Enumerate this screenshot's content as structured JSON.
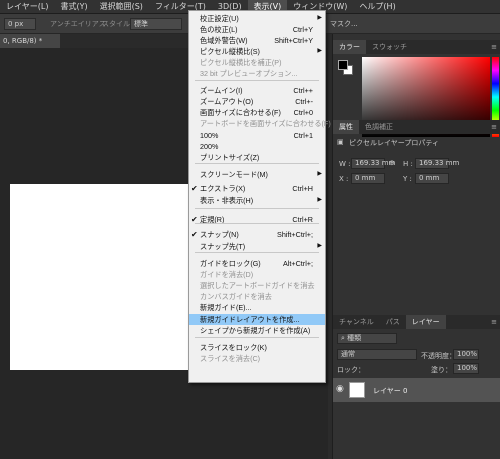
{
  "menubar": {
    "items": [
      "レイヤー(L)",
      "書式(Y)",
      "選択範囲(S)",
      "フィルター(T)",
      "3D(D)",
      "表示(V)",
      "ウィンドウ(W)",
      "ヘルプ(H)"
    ],
    "active_index": 5
  },
  "options_bar": {
    "field_value": "0 px",
    "antialias_label": "アンチエイリアス",
    "style_label": "スタイル：",
    "style_value": "標準",
    "right_text": "マスク..."
  },
  "document_tab": {
    "label": "0, RGB/8) *"
  },
  "view_menu": {
    "items": [
      {
        "label": "校正設定(U)",
        "shortcut": "",
        "submenu": true,
        "disabled": false,
        "checked": false,
        "highlight": false
      },
      {
        "label": "色の校正(L)",
        "shortcut": "Ctrl+Y",
        "submenu": false,
        "disabled": false,
        "checked": false,
        "highlight": false
      },
      {
        "label": "色域外警告(W)",
        "shortcut": "Shift+Ctrl+Y",
        "submenu": false,
        "disabled": false,
        "checked": false,
        "highlight": false
      },
      {
        "label": "ピクセル縦横比(S)",
        "shortcut": "",
        "submenu": true,
        "disabled": false,
        "checked": false,
        "highlight": false
      },
      {
        "label": "ピクセル縦横比を補正(P)",
        "shortcut": "",
        "submenu": false,
        "disabled": true,
        "checked": false,
        "highlight": false
      },
      {
        "label": "32 bit プレビューオプション...",
        "shortcut": "",
        "submenu": false,
        "disabled": true,
        "checked": false,
        "highlight": false
      },
      {
        "label": "ズームイン(I)",
        "shortcut": "Ctrl++",
        "submenu": false,
        "disabled": false,
        "checked": false,
        "highlight": false
      },
      {
        "label": "ズームアウト(O)",
        "shortcut": "Ctrl+-",
        "submenu": false,
        "disabled": false,
        "checked": false,
        "highlight": false
      },
      {
        "label": "画面サイズに合わせる(F)",
        "shortcut": "Ctrl+0",
        "submenu": false,
        "disabled": false,
        "checked": false,
        "highlight": false
      },
      {
        "label": "アートボードを画面サイズに合わせる(F)",
        "shortcut": "",
        "submenu": false,
        "disabled": true,
        "checked": false,
        "highlight": false
      },
      {
        "label": "100%",
        "shortcut": "Ctrl+1",
        "submenu": false,
        "disabled": false,
        "checked": false,
        "highlight": false
      },
      {
        "label": "200%",
        "shortcut": "",
        "submenu": false,
        "disabled": false,
        "checked": false,
        "highlight": false
      },
      {
        "label": "プリントサイズ(Z)",
        "shortcut": "",
        "submenu": false,
        "disabled": false,
        "checked": false,
        "highlight": false
      },
      {
        "label": "スクリーンモード(M)",
        "shortcut": "",
        "submenu": true,
        "disabled": false,
        "checked": false,
        "highlight": false
      },
      {
        "label": "エクストラ(X)",
        "shortcut": "Ctrl+H",
        "submenu": false,
        "disabled": false,
        "checked": true,
        "highlight": false
      },
      {
        "label": "表示・非表示(H)",
        "shortcut": "",
        "submenu": true,
        "disabled": false,
        "checked": false,
        "highlight": false
      },
      {
        "label": "定規(R)",
        "shortcut": "Ctrl+R",
        "submenu": false,
        "disabled": false,
        "checked": true,
        "highlight": false
      },
      {
        "label": "スナップ(N)",
        "shortcut": "Shift+Ctrl+;",
        "submenu": false,
        "disabled": false,
        "checked": true,
        "highlight": false
      },
      {
        "label": "スナップ先(T)",
        "shortcut": "",
        "submenu": true,
        "disabled": false,
        "checked": false,
        "highlight": false
      },
      {
        "label": "ガイドをロック(G)",
        "shortcut": "Alt+Ctrl+;",
        "submenu": false,
        "disabled": false,
        "checked": false,
        "highlight": false
      },
      {
        "label": "ガイドを消去(D)",
        "shortcut": "",
        "submenu": false,
        "disabled": true,
        "checked": false,
        "highlight": false
      },
      {
        "label": "選択したアートボードガイドを消去",
        "shortcut": "",
        "submenu": false,
        "disabled": true,
        "checked": false,
        "highlight": false
      },
      {
        "label": "カンバスガイドを消去",
        "shortcut": "",
        "submenu": false,
        "disabled": true,
        "checked": false,
        "highlight": false
      },
      {
        "label": "新規ガイド(E)...",
        "shortcut": "",
        "submenu": false,
        "disabled": false,
        "checked": false,
        "highlight": false
      },
      {
        "label": "新規ガイドレイアウトを作成...",
        "shortcut": "",
        "submenu": false,
        "disabled": false,
        "checked": false,
        "highlight": true
      },
      {
        "label": "シェイプから新規ガイドを作成(A)",
        "shortcut": "",
        "submenu": false,
        "disabled": false,
        "checked": false,
        "highlight": false
      },
      {
        "label": "スライスをロック(K)",
        "shortcut": "",
        "submenu": false,
        "disabled": false,
        "checked": false,
        "highlight": false
      },
      {
        "label": "スライスを消去(C)",
        "shortcut": "",
        "submenu": false,
        "disabled": true,
        "checked": false,
        "highlight": false
      }
    ]
  },
  "color_panel": {
    "tabs": [
      "カラー",
      "スウォッチ"
    ],
    "active_tab": 0
  },
  "properties_panel": {
    "tabs": [
      "属性",
      "色調補正"
    ],
    "active_tab": 0,
    "header": "ピクセルレイヤープロパティ",
    "w_label": "W :",
    "w_value": "169.33 mm",
    "h_label": "H :",
    "h_value": "169.33 mm",
    "x_label": "X :",
    "x_value": "0 mm",
    "y_label": "Y :",
    "y_value": "0 mm"
  },
  "layers_panel": {
    "tabs": [
      "チャンネル",
      "パス",
      "レイヤー"
    ],
    "active_tab": 2,
    "filter_label": "種類",
    "blend_mode": "通常",
    "opacity_label": "不透明度：",
    "opacity_value": "100%",
    "lock_label": "ロック：",
    "fill_label": "塗り：",
    "fill_value": "100%",
    "layer_name": "レイヤー 0"
  }
}
